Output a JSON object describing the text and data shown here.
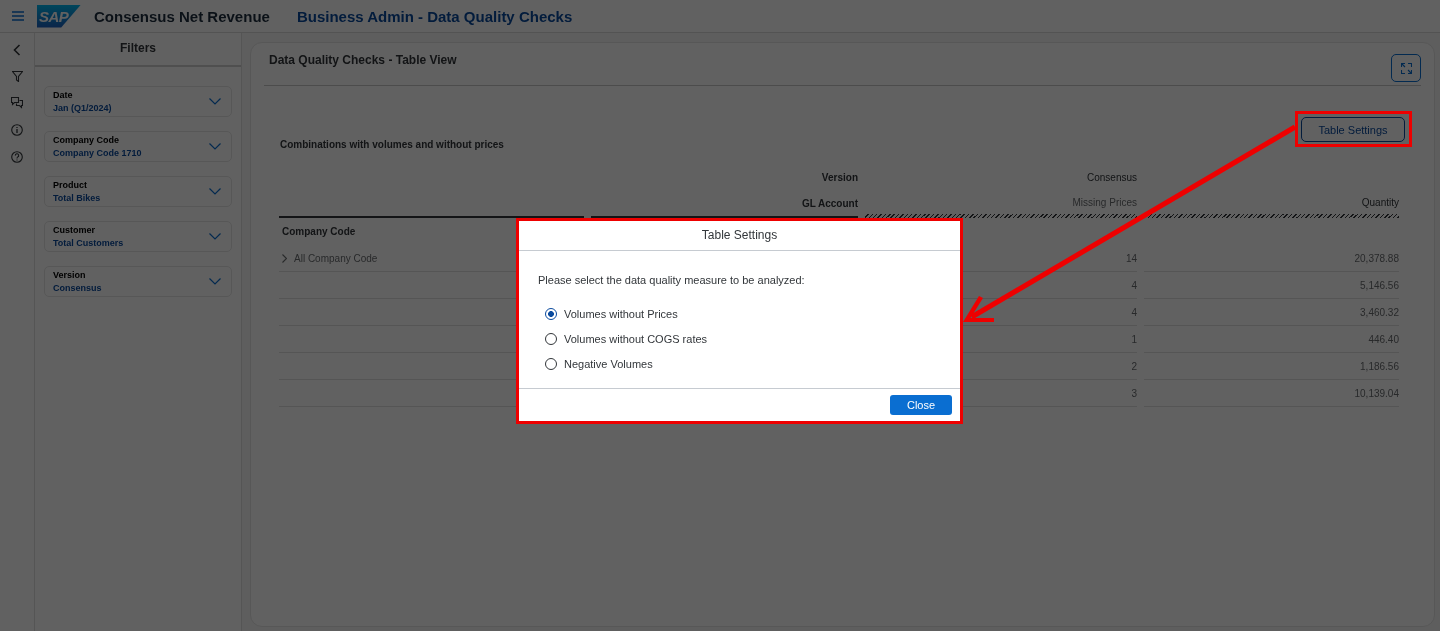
{
  "header": {
    "logo_text": "SAP",
    "app_title": "Consensus Net Revenue",
    "page_title": "Business Admin - Data Quality Checks"
  },
  "filters": {
    "title": "Filters",
    "items": [
      {
        "label": "Date",
        "value": "Jan (Q1/2024)"
      },
      {
        "label": "Company Code",
        "value": "Company Code 1710"
      },
      {
        "label": "Product",
        "value": "Total Bikes"
      },
      {
        "label": "Customer",
        "value": "Total Customers"
      },
      {
        "label": "Version",
        "value": "Consensus"
      }
    ]
  },
  "card": {
    "title": "Data Quality Checks - Table View",
    "table_settings_button": "Table Settings",
    "subtitle": "Combinations with volumes and without prices",
    "table": {
      "dimension_headers": [
        "Version",
        "GL Account"
      ],
      "version_value": "Consensus",
      "columns": [
        "Missing Prices",
        "Quantity"
      ],
      "row_header": "Company Code",
      "rows": [
        {
          "label": "All Company Code",
          "expandable": true,
          "values": [
            "14",
            "20,378.88"
          ]
        },
        {
          "values": [
            "4",
            "5,146.56"
          ]
        },
        {
          "values": [
            "4",
            "3,460.32"
          ]
        },
        {
          "values": [
            "1",
            "446.40"
          ]
        },
        {
          "values": [
            "2",
            "1,186.56"
          ]
        },
        {
          "values": [
            "3",
            "10,139.04"
          ]
        }
      ]
    }
  },
  "dialog": {
    "title": "Table Settings",
    "prompt": "Please select the data quality measure to be analyzed:",
    "options": [
      {
        "label": "Volumes without Prices",
        "selected": true
      },
      {
        "label": "Volumes without COGS rates",
        "selected": false
      },
      {
        "label": "Negative Volumes",
        "selected": false
      }
    ],
    "close_button": "Close"
  }
}
